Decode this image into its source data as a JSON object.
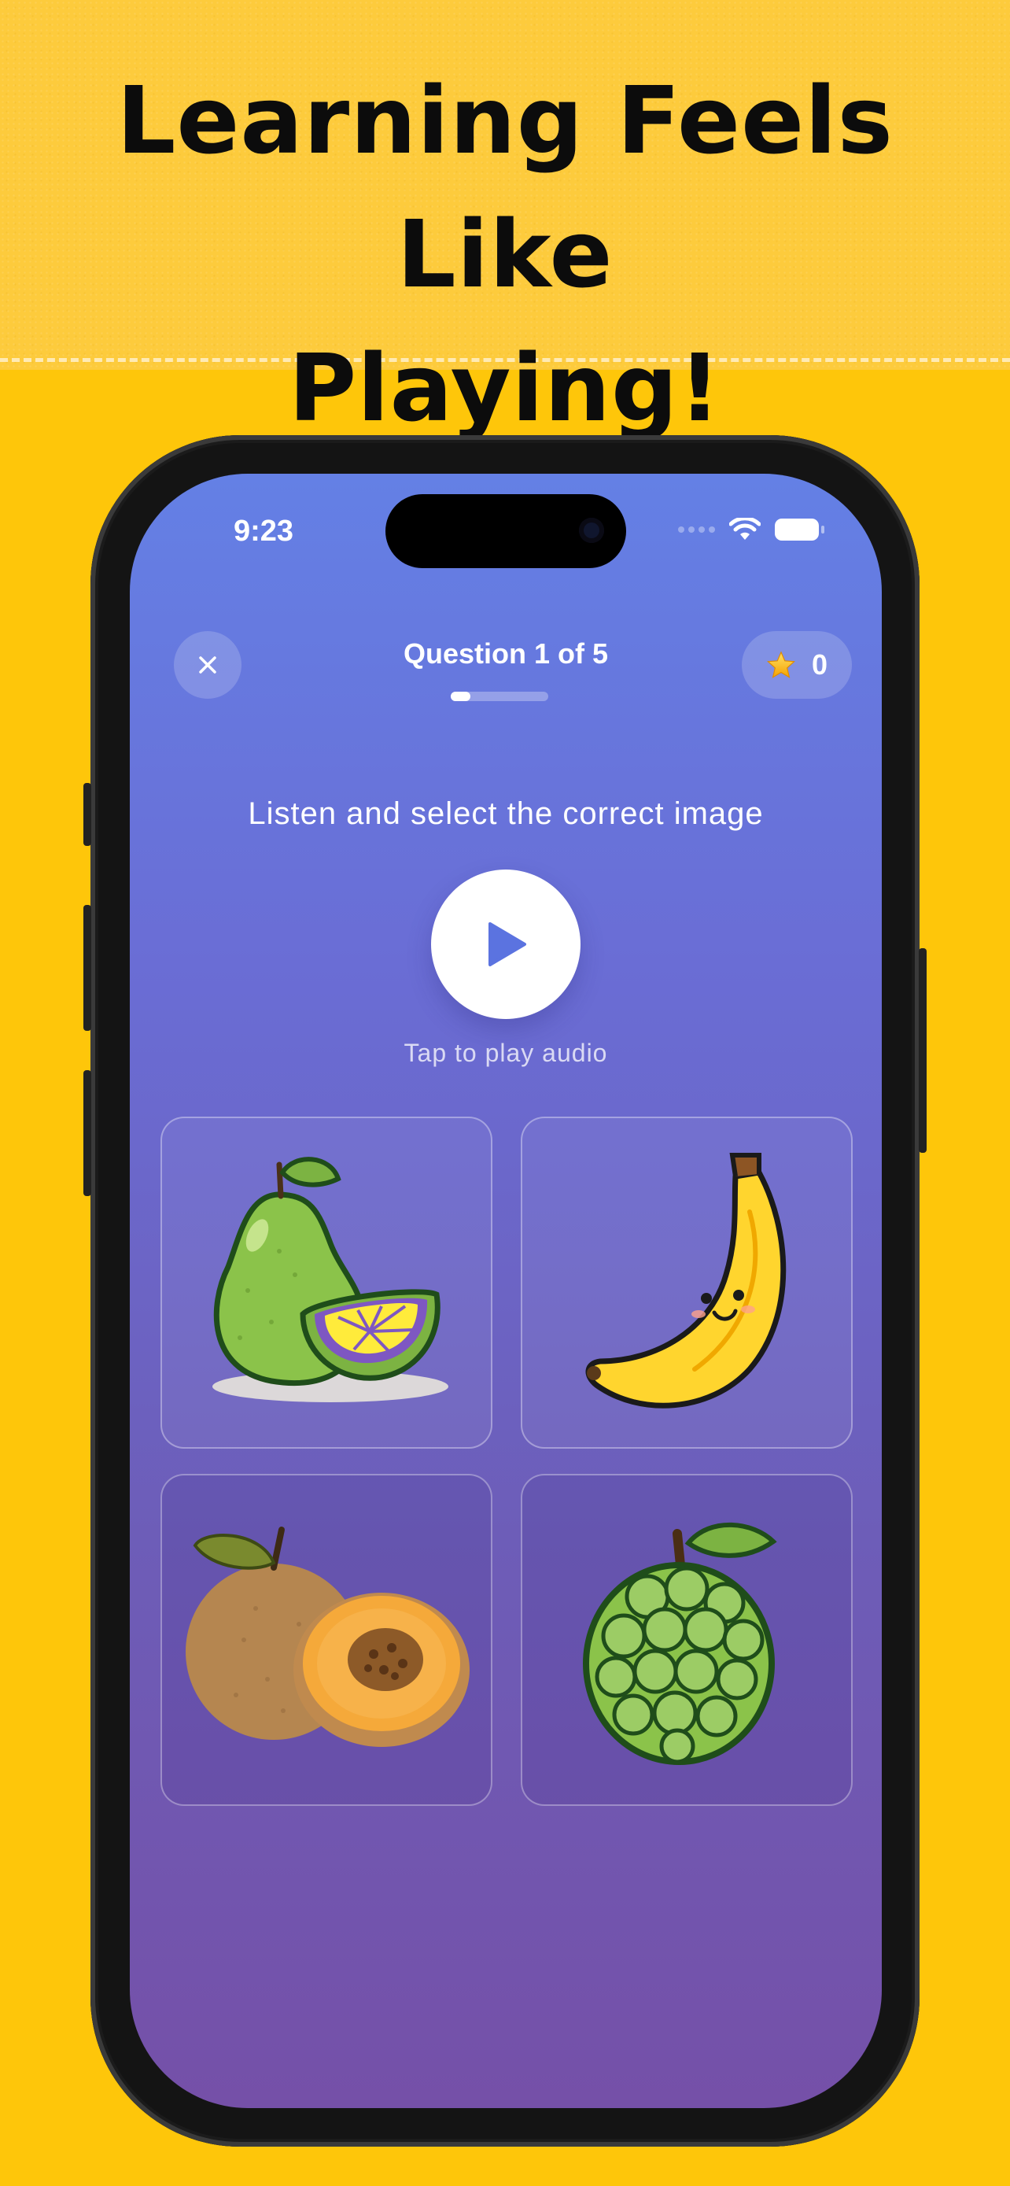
{
  "banner": {
    "headline_line1": "Learning Feels Like",
    "headline_line2": "Playing!"
  },
  "status_bar": {
    "time": "9:23"
  },
  "quiz": {
    "title": "Question 1 of 5",
    "progress_fraction": 0.2,
    "score": "0",
    "instruction": "Listen and select the correct image",
    "audio_hint": "Tap to play audio"
  },
  "options": [
    {
      "icon": "pomelo-icon"
    },
    {
      "icon": "banana-icon"
    },
    {
      "icon": "sapodilla-icon"
    },
    {
      "icon": "custard-apple-icon"
    }
  ],
  "colors": {
    "background": "#FEC60A",
    "screen_top": "#6480E5",
    "screen_bottom": "#7550A8",
    "accent": "#5B73E0"
  }
}
